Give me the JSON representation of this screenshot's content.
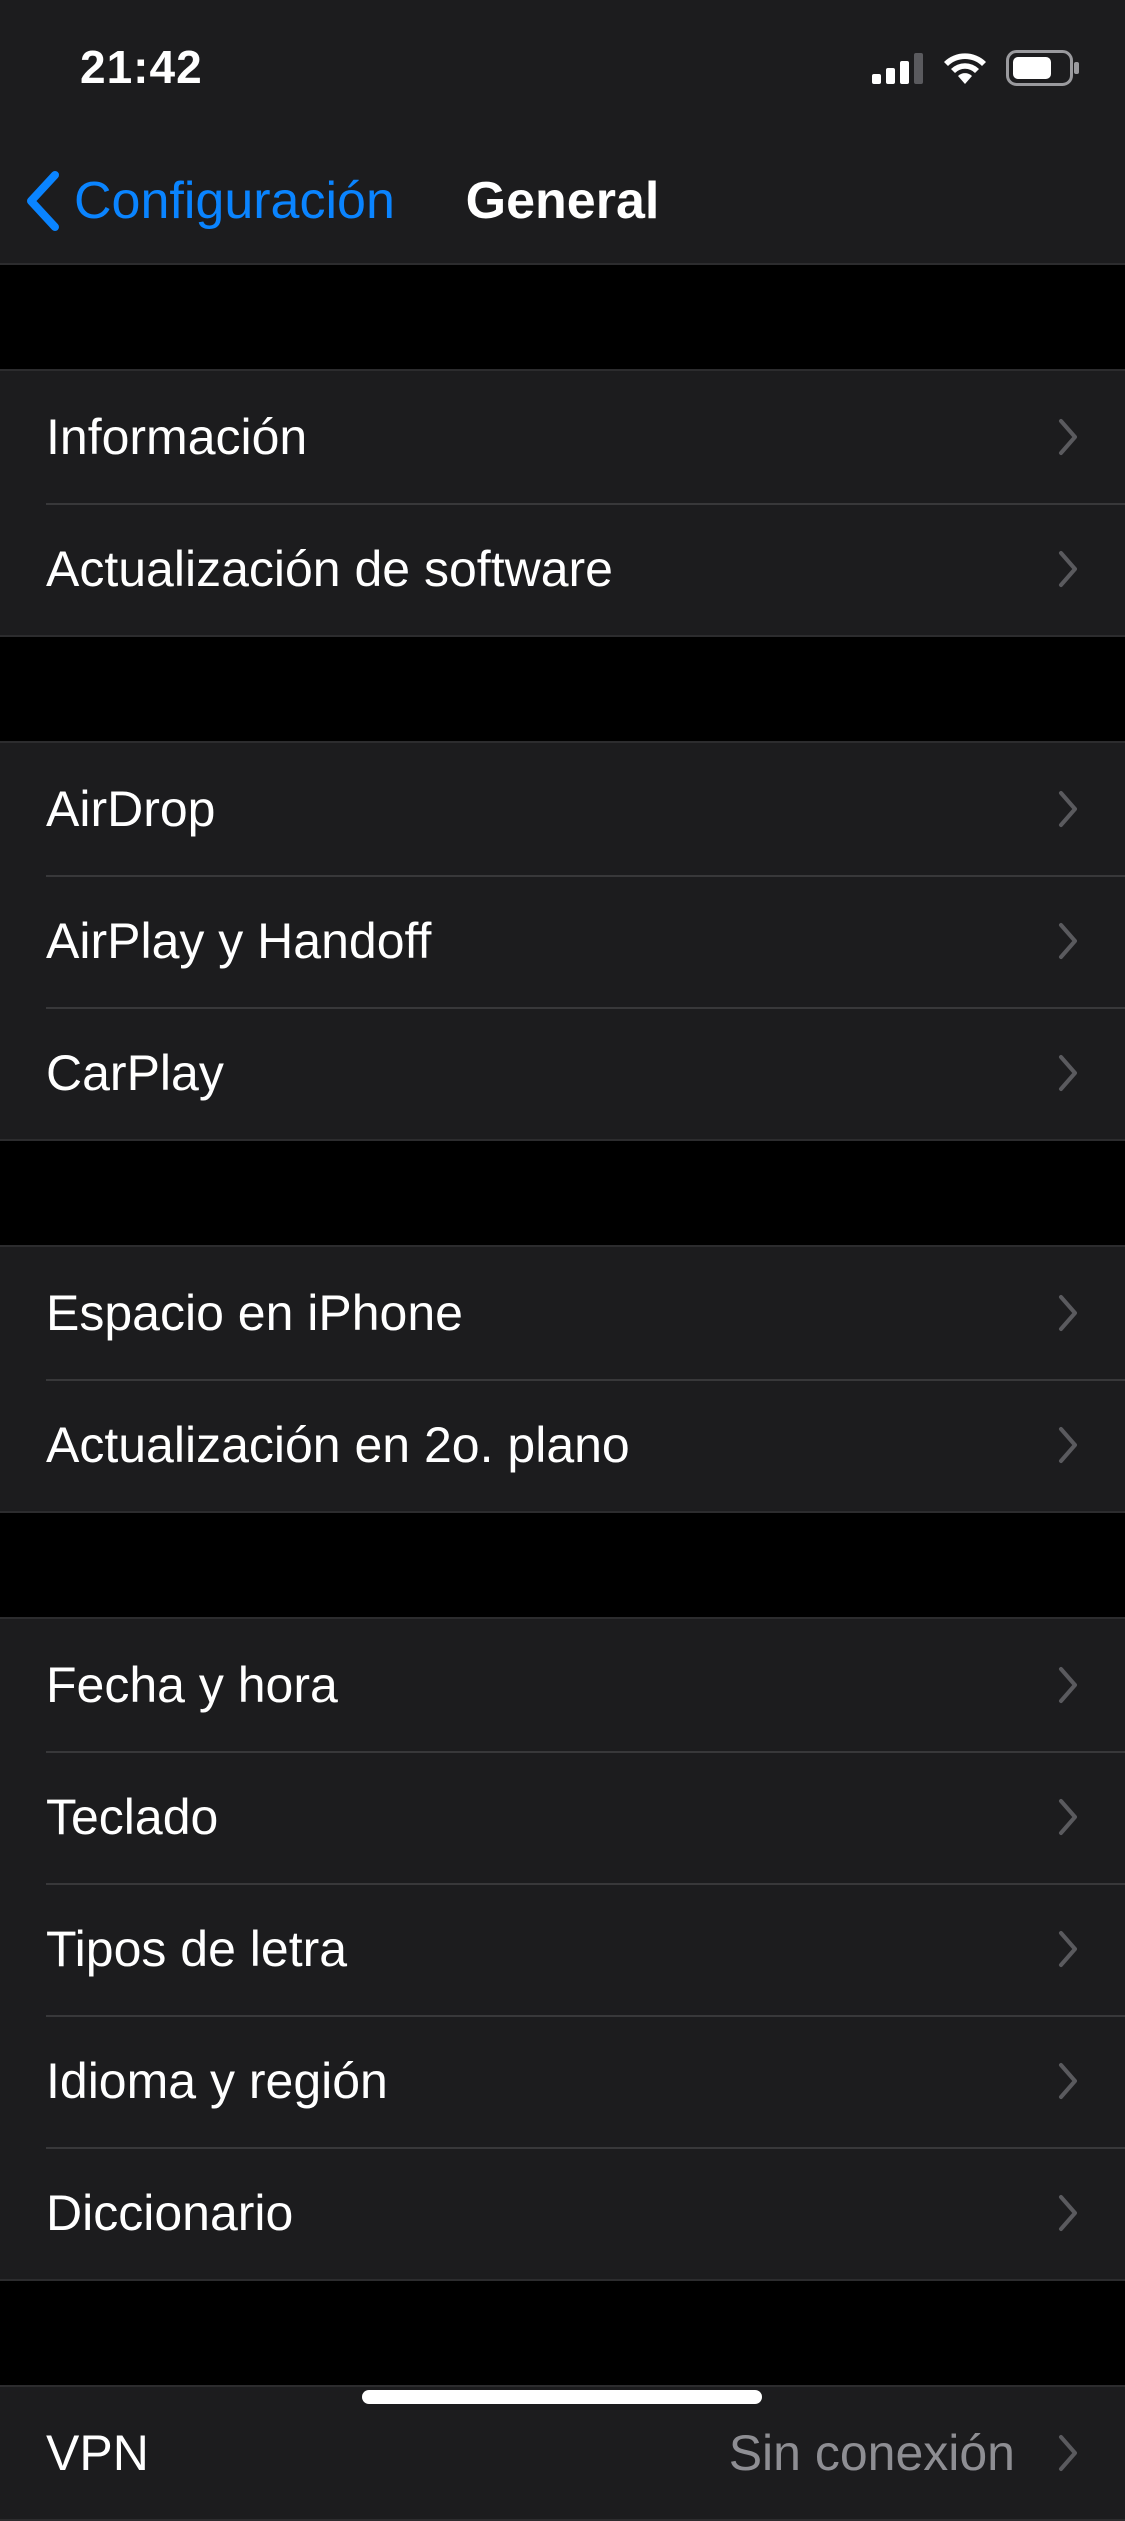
{
  "status_bar": {
    "time": "21:42"
  },
  "nav": {
    "back_label": "Configuración",
    "title": "General"
  },
  "groups": [
    {
      "items": [
        {
          "label": "Información"
        },
        {
          "label": "Actualización de software"
        }
      ]
    },
    {
      "items": [
        {
          "label": "AirDrop"
        },
        {
          "label": "AirPlay y Handoff"
        },
        {
          "label": "CarPlay"
        }
      ]
    },
    {
      "items": [
        {
          "label": "Espacio en iPhone"
        },
        {
          "label": "Actualización en 2o. plano"
        }
      ]
    },
    {
      "items": [
        {
          "label": "Fecha y hora"
        },
        {
          "label": "Teclado"
        },
        {
          "label": "Tipos de letra"
        },
        {
          "label": "Idioma y región"
        },
        {
          "label": "Diccionario"
        }
      ]
    },
    {
      "items": [
        {
          "label": "VPN",
          "value": "Sin conexión"
        }
      ]
    }
  ],
  "colors": {
    "accent": "#0a84ff",
    "background": "#000000",
    "cell": "#1c1c1e",
    "separator": "#38383a",
    "secondary_text": "#8e8e93"
  },
  "icons": [
    "cellular-signal-icon",
    "wifi-icon",
    "battery-icon",
    "chevron-left-icon",
    "chevron-right-icon"
  ]
}
